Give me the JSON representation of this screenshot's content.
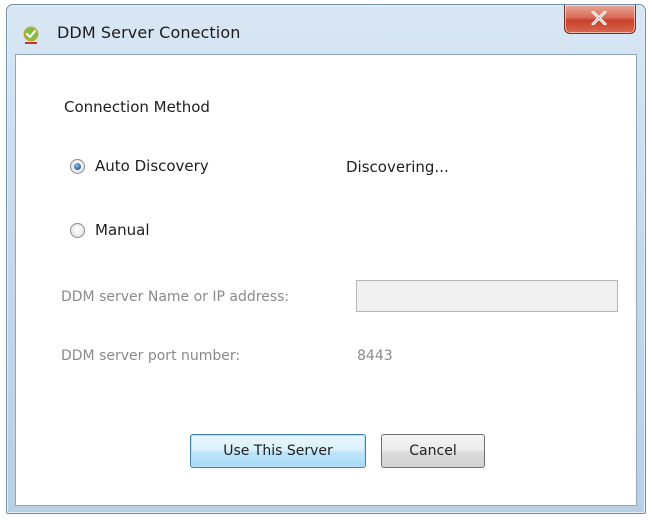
{
  "window": {
    "title": "DDM Server Conection",
    "close_label": "X"
  },
  "connection": {
    "section_label": "Connection Method",
    "auto_discovery_label": "Auto Discovery",
    "auto_discovery_selected": true,
    "status": "Discovering...",
    "manual_label": "Manual",
    "manual_selected": false
  },
  "server": {
    "name_label": "DDM server Name or IP address:",
    "name_value": "",
    "port_label": "DDM server port number:",
    "port_value": "8443"
  },
  "buttons": {
    "use_server": "Use This Server",
    "cancel": "Cancel"
  },
  "colors": {
    "title_bar": "#c7d9ec",
    "close_button": "#c8412b",
    "disabled_text": "#8a8a8a",
    "default_button_border": "#3c7fb1"
  },
  "icons": {
    "app": "green-check-globe-icon",
    "close": "close-icon"
  }
}
